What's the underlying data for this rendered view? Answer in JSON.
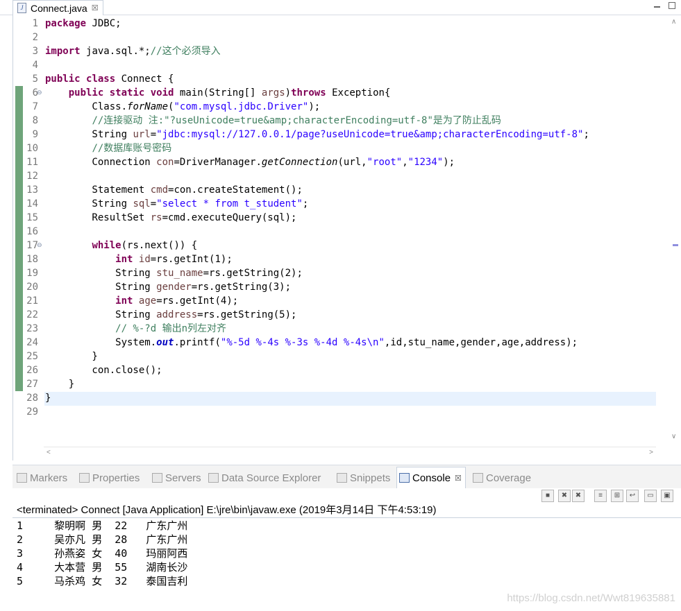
{
  "editor_tab": {
    "title": "Connect.java",
    "close": "☒"
  },
  "gutter": {
    "line_numbers": [
      "1",
      "2",
      "3",
      "4",
      "5",
      "6",
      "7",
      "8",
      "9",
      "10",
      "11",
      "12",
      "13",
      "14",
      "15",
      "16",
      "17",
      "18",
      "19",
      "20",
      "21",
      "22",
      "23",
      "24",
      "25",
      "26",
      "27",
      "28",
      "29"
    ],
    "current_line": "27"
  },
  "code_lines": [
    [
      [
        "kw",
        "package"
      ],
      [
        "",
        "JDBC;"
      ]
    ],
    [],
    [
      [
        "kw",
        "import"
      ],
      [
        "",
        "java.sql.*;"
      ],
      [
        "cm",
        "//这个必须导入"
      ]
    ],
    [],
    [
      [
        "kw",
        "public"
      ],
      [
        "",
        ""
      ],
      [
        "kw",
        "class"
      ],
      [
        "",
        "Connect {"
      ]
    ],
    [
      [
        "",
        "    "
      ],
      [
        "kw",
        "public"
      ],
      [
        "",
        ""
      ],
      [
        "kw",
        "static"
      ],
      [
        "",
        ""
      ],
      [
        "kw",
        "void"
      ],
      [
        "",
        "main(String[] "
      ],
      [
        "vr",
        "args"
      ],
      [
        "",
        ")"
      ],
      [
        "kw",
        "throws"
      ],
      [
        "",
        "Exception{"
      ]
    ],
    [
      [
        "",
        "        Class."
      ],
      [
        "it",
        "forName"
      ],
      [
        "",
        "("
      ],
      [
        "str",
        "\"com.mysql.jdbc.Driver\""
      ],
      [
        "",
        ");"
      ]
    ],
    [
      [
        "",
        "        "
      ],
      [
        "cm",
        "//连接驱动 注:\"?useUnicode=true&amp;characterEncoding=utf-8\"是为了防止乱码"
      ]
    ],
    [
      [
        "",
        "        String "
      ],
      [
        "vr",
        "url"
      ],
      [
        "",
        "="
      ],
      [
        "str",
        "\"jdbc:mysql://127.0.0.1/page?useUnicode=true&amp;characterEncoding=utf-8\""
      ],
      [
        "",
        ";"
      ]
    ],
    [
      [
        "",
        "        "
      ],
      [
        "cm",
        "//数据库账号密码"
      ]
    ],
    [
      [
        "",
        "        Connection "
      ],
      [
        "vr",
        "con"
      ],
      [
        "",
        "=DriverManager."
      ],
      [
        "it",
        "getConnection"
      ],
      [
        "",
        "(url,"
      ],
      [
        "str",
        "\"root\""
      ],
      [
        "",
        ","
      ],
      [
        "str",
        "\"1234\""
      ],
      [
        "",
        ");"
      ]
    ],
    [],
    [
      [
        "",
        "        Statement "
      ],
      [
        "vr",
        "cmd"
      ],
      [
        "",
        "=con.createStatement();"
      ]
    ],
    [
      [
        "",
        "        String "
      ],
      [
        "vr",
        "sql"
      ],
      [
        "",
        "="
      ],
      [
        "str",
        "\"select * from t_student\""
      ],
      [
        "",
        ";"
      ]
    ],
    [
      [
        "",
        "        ResultSet "
      ],
      [
        "vr",
        "rs"
      ],
      [
        "",
        "=cmd.executeQuery(sql);"
      ]
    ],
    [],
    [
      [
        "",
        "        "
      ],
      [
        "kw",
        "while"
      ],
      [
        "",
        "(rs.next()) {"
      ]
    ],
    [
      [
        "",
        "            "
      ],
      [
        "kw",
        "int"
      ],
      [
        "",
        ""
      ],
      [
        "vr",
        "id"
      ],
      [
        "",
        "=rs.getInt(1);"
      ]
    ],
    [
      [
        "",
        "            String "
      ],
      [
        "vr",
        "stu_name"
      ],
      [
        "",
        "=rs.getString(2);"
      ]
    ],
    [
      [
        "",
        "            String "
      ],
      [
        "vr",
        "gender"
      ],
      [
        "",
        "=rs.getString(3);"
      ]
    ],
    [
      [
        "",
        "            "
      ],
      [
        "kw",
        "int"
      ],
      [
        "",
        ""
      ],
      [
        "vr",
        "age"
      ],
      [
        "",
        "=rs.getInt(4);"
      ]
    ],
    [
      [
        "",
        "            String "
      ],
      [
        "vr",
        "address"
      ],
      [
        "",
        "=rs.getString(5);"
      ]
    ],
    [
      [
        "",
        "            "
      ],
      [
        "cm",
        "// %-?d 输出n列左对齐"
      ]
    ],
    [
      [
        "",
        "            System."
      ],
      [
        "fld",
        "out"
      ],
      [
        "",
        ".printf("
      ],
      [
        "str",
        "\"%-5d %-4s %-3s %-4d %-4s\\n\""
      ],
      [
        "",
        ",id,stu_name,gender,age,address);"
      ]
    ],
    [
      [
        "",
        "        }"
      ]
    ],
    [
      [
        "",
        "        con.close();"
      ]
    ],
    [
      [
        "",
        "    }"
      ]
    ],
    [
      [
        "",
        "}"
      ]
    ],
    []
  ],
  "bottom_tabs": [
    {
      "label": "Markers",
      "active": false
    },
    {
      "label": "Properties",
      "active": false
    },
    {
      "label": "Servers",
      "active": false
    },
    {
      "label": "Data Source Explorer",
      "active": false
    },
    {
      "label": "Snippets",
      "active": false
    },
    {
      "label": "Console",
      "active": true
    },
    {
      "label": "Coverage",
      "active": false
    }
  ],
  "console": {
    "header": "<terminated> Connect [Java Application] E:\\jre\\bin\\javaw.exe (2019年3月14日 下午4:53:19)",
    "rows": [
      "1     黎明啊 男  22   广东广州",
      "2     吴亦凡 男  28   广东广州",
      "3     孙燕姿 女  40   玛丽阿西",
      "4     大本营 男  55   湖南长沙",
      "5     马杀鸡 女  32   泰国吉利"
    ]
  },
  "watermark": "https://blog.csdn.net/Wwt819635881",
  "colors": {
    "keyword": "#7f0055",
    "string": "#2a00ff",
    "comment": "#3f7f5f",
    "current_line": "#e8f2fe"
  }
}
